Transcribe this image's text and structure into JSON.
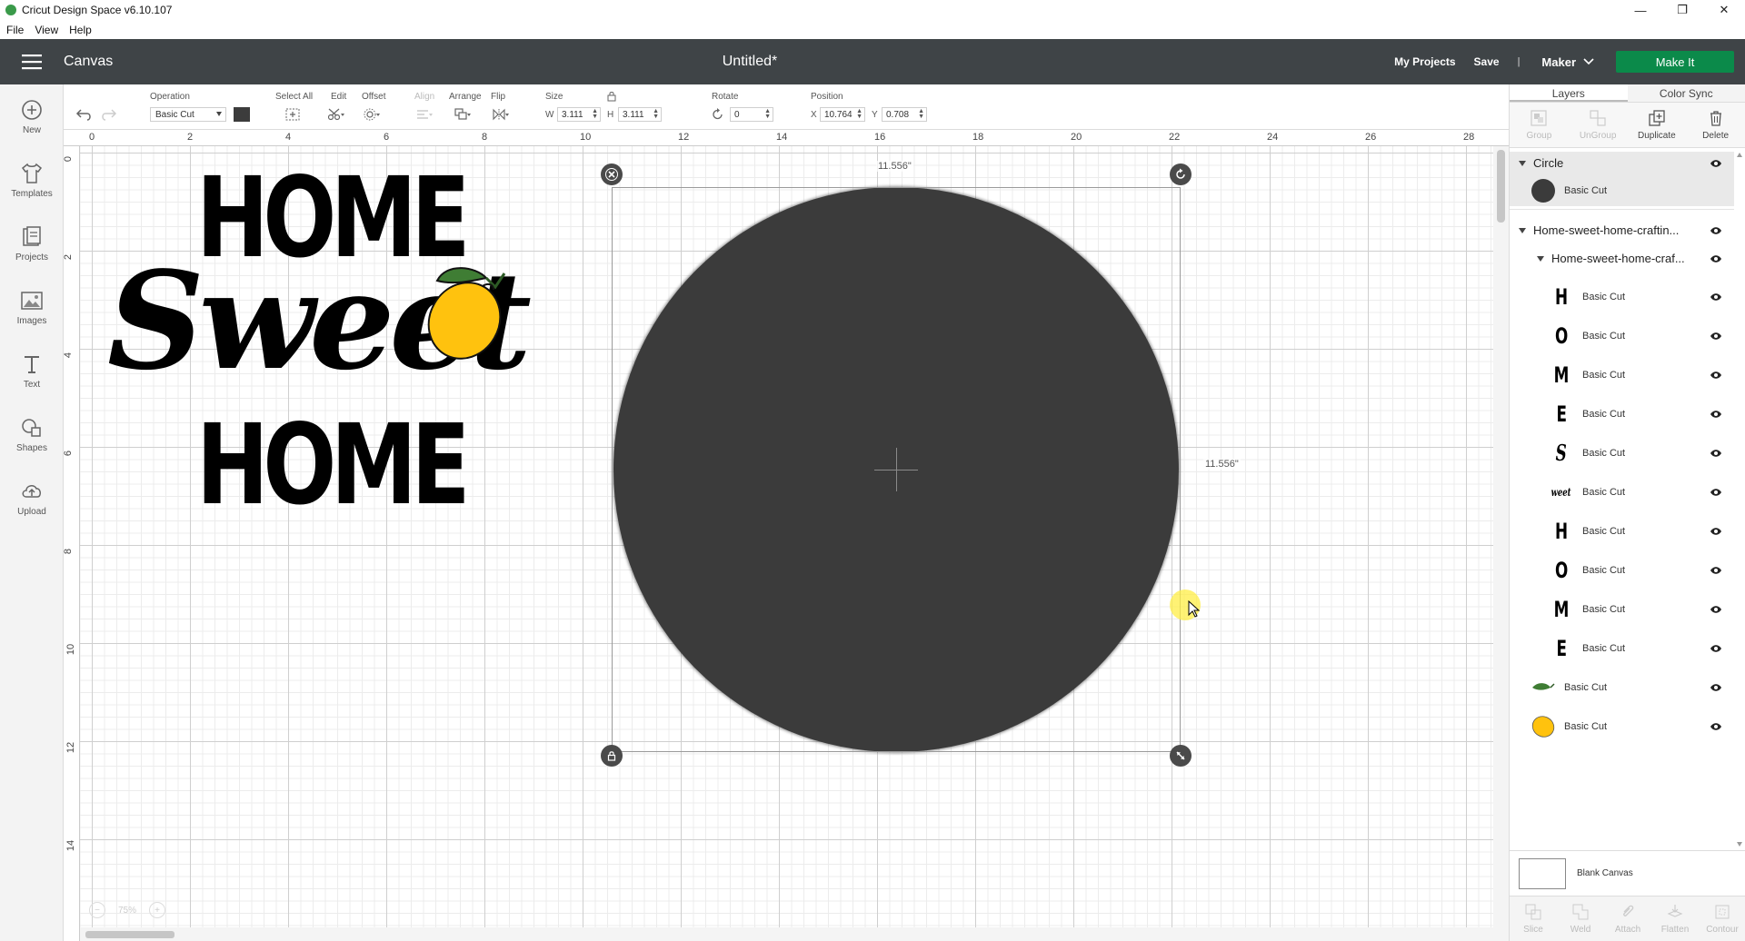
{
  "window": {
    "title": "Cricut Design Space  v6.10.107",
    "controls": [
      "—",
      "❐",
      "✕"
    ]
  },
  "menubar": [
    "File",
    "View",
    "Help"
  ],
  "header": {
    "section": "Canvas",
    "document_title": "Untitled*",
    "my_projects": "My Projects",
    "save": "Save",
    "separator": "|",
    "machine": "Maker",
    "make_it": "Make It"
  },
  "leftrail": [
    {
      "label": "New",
      "icon": "plus-circle-icon"
    },
    {
      "label": "Templates",
      "icon": "shirt-icon"
    },
    {
      "label": "Projects",
      "icon": "projects-icon"
    },
    {
      "label": "Images",
      "icon": "image-icon"
    },
    {
      "label": "Text",
      "icon": "text-icon"
    },
    {
      "label": "Shapes",
      "icon": "shapes-icon"
    },
    {
      "label": "Upload",
      "icon": "upload-cloud-icon"
    }
  ],
  "toolbar": {
    "operation_label": "Operation",
    "operation_value": "Basic Cut",
    "operation_color": "#3c3c3c",
    "select_all": "Select All",
    "edit": "Edit",
    "offset": "Offset",
    "align": "Align",
    "arrange": "Arrange",
    "flip": "Flip",
    "size": "Size",
    "w_label": "W",
    "w_value": "3.111",
    "h_label": "H",
    "h_value": "3.111",
    "rotate": "Rotate",
    "rotate_value": "0",
    "position": "Position",
    "x_label": "X",
    "x_value": "10.764",
    "y_label": "Y",
    "y_value": "0.708"
  },
  "ruler": {
    "top": [
      "0",
      "2",
      "4",
      "6",
      "8",
      "10",
      "12",
      "14",
      "16",
      "18",
      "20",
      "22",
      "24",
      "26",
      "28"
    ],
    "left": [
      "0",
      "2",
      "4",
      "6",
      "8",
      "10",
      "12",
      "14"
    ]
  },
  "canvas": {
    "design": {
      "line1": "HOME",
      "line2": "Sweet",
      "line3": "HOME"
    },
    "width_readout": "11.556\"",
    "height_readout": "11.556\"",
    "circle_color": "#3b3b3b",
    "lemon_color": "#ffc20e",
    "leaf_color": "#3f7d34",
    "zoom": "75%"
  },
  "panel": {
    "tabs": [
      "Layers",
      "Color Sync"
    ],
    "actions": [
      {
        "label": "Group",
        "enabled": false
      },
      {
        "label": "UnGroup",
        "enabled": false
      },
      {
        "label": "Duplicate",
        "enabled": true
      },
      {
        "label": "Delete",
        "enabled": true
      }
    ],
    "circle_group": "Circle",
    "circle_layer": "Basic Cut",
    "group1": "Home-sweet-home-craftin...",
    "group2": "Home-sweet-home-craf...",
    "letters": [
      {
        "glyph": "H",
        "op": "Basic Cut"
      },
      {
        "glyph": "O",
        "op": "Basic Cut"
      },
      {
        "glyph": "M",
        "op": "Basic Cut"
      },
      {
        "glyph": "E",
        "op": "Basic Cut"
      },
      {
        "glyph": "S",
        "op": "Basic Cut"
      },
      {
        "glyph": "weet",
        "op": "Basic Cut"
      },
      {
        "glyph": "H",
        "op": "Basic Cut"
      },
      {
        "glyph": "O",
        "op": "Basic Cut"
      },
      {
        "glyph": "M",
        "op": "Basic Cut"
      },
      {
        "glyph": "E",
        "op": "Basic Cut"
      }
    ],
    "leaf_layer": "Basic Cut",
    "lemon_layer": "Basic Cut",
    "blank_canvas": "Blank Canvas",
    "bottom_actions": [
      "Slice",
      "Weld",
      "Attach",
      "Flatten",
      "Contour"
    ]
  }
}
